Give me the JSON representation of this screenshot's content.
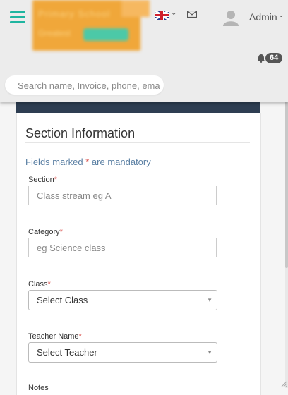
{
  "header": {
    "logo": {
      "text_line1": "Primary School",
      "text_line2": "Greatest",
      "button_text": "Button"
    },
    "language_icon": "uk-flag-icon",
    "mail_icon": "mail-icon",
    "user": {
      "name": "Admin"
    },
    "notifications": {
      "count": "64"
    },
    "search": {
      "placeholder": "Search name, Invoice, phone, email"
    }
  },
  "form": {
    "title": "Section Information",
    "mandatory_prefix": "Fields marked ",
    "mandatory_star": "*",
    "mandatory_suffix": " are mandatory",
    "required_mark": "*",
    "fields": {
      "section": {
        "label": "Section",
        "placeholder": "Class stream eg A"
      },
      "category": {
        "label": "Category",
        "placeholder": "eg Science class"
      },
      "class": {
        "label": "Class",
        "selected": "Select Class"
      },
      "teacher": {
        "label": "Teacher Name",
        "selected": "Select Teacher"
      },
      "notes": {
        "label": "Notes"
      }
    }
  },
  "colors": {
    "accent": "#1fb5a0",
    "logo_bg": "#f0a73a",
    "dark_band": "#2e3e52",
    "required": "#d9534f",
    "link_text": "#5a7fa3"
  }
}
